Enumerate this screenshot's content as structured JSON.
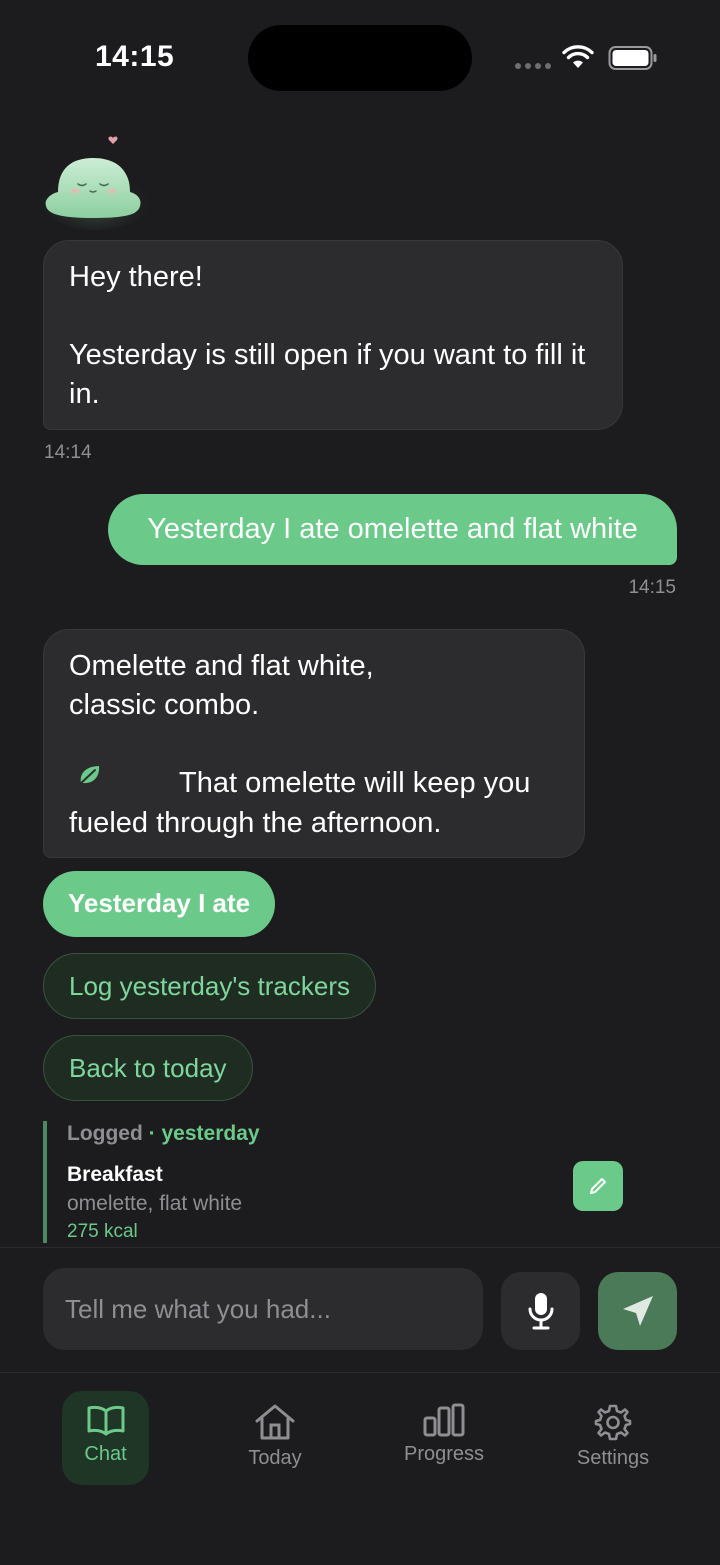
{
  "status_bar": {
    "time": "14:15"
  },
  "messages": {
    "bot_1": {
      "text": "Hey there!\n\nYesterday is still open if you want to fill it in.",
      "time": "14:14"
    },
    "user_1": {
      "text": "Yesterday I ate omelette and flat white",
      "time": "14:15"
    },
    "bot_2": {
      "text_a": "Omelette and flat white,\nclassic combo.\n\n",
      "text_b": "That omelette will keep you fueled through the afternoon.",
      "icon": "leaf-icon"
    }
  },
  "chips": {
    "primary": "Yesterday I ate",
    "secondary_1": "Log yesterday's trackers",
    "secondary_2": "Back to today"
  },
  "logged_card": {
    "label": "Logged",
    "separator": " · ",
    "day": "yesterday",
    "meal": "Breakfast",
    "items": "omelette, flat white",
    "kcal": "275 kcal"
  },
  "composer": {
    "placeholder": "Tell me what you had..."
  },
  "tabs": [
    {
      "label": "Chat",
      "icon": "book-icon",
      "active": true
    },
    {
      "label": "Today",
      "icon": "home-icon",
      "active": false
    },
    {
      "label": "Progress",
      "icon": "bar-chart-icon",
      "active": false
    },
    {
      "label": "Settings",
      "icon": "gear-icon",
      "active": false
    }
  ],
  "colors": {
    "accent": "#6bc98a",
    "background": "#1c1c1e",
    "bubble": "#2c2c2e",
    "send_button": "#4a7a57"
  }
}
